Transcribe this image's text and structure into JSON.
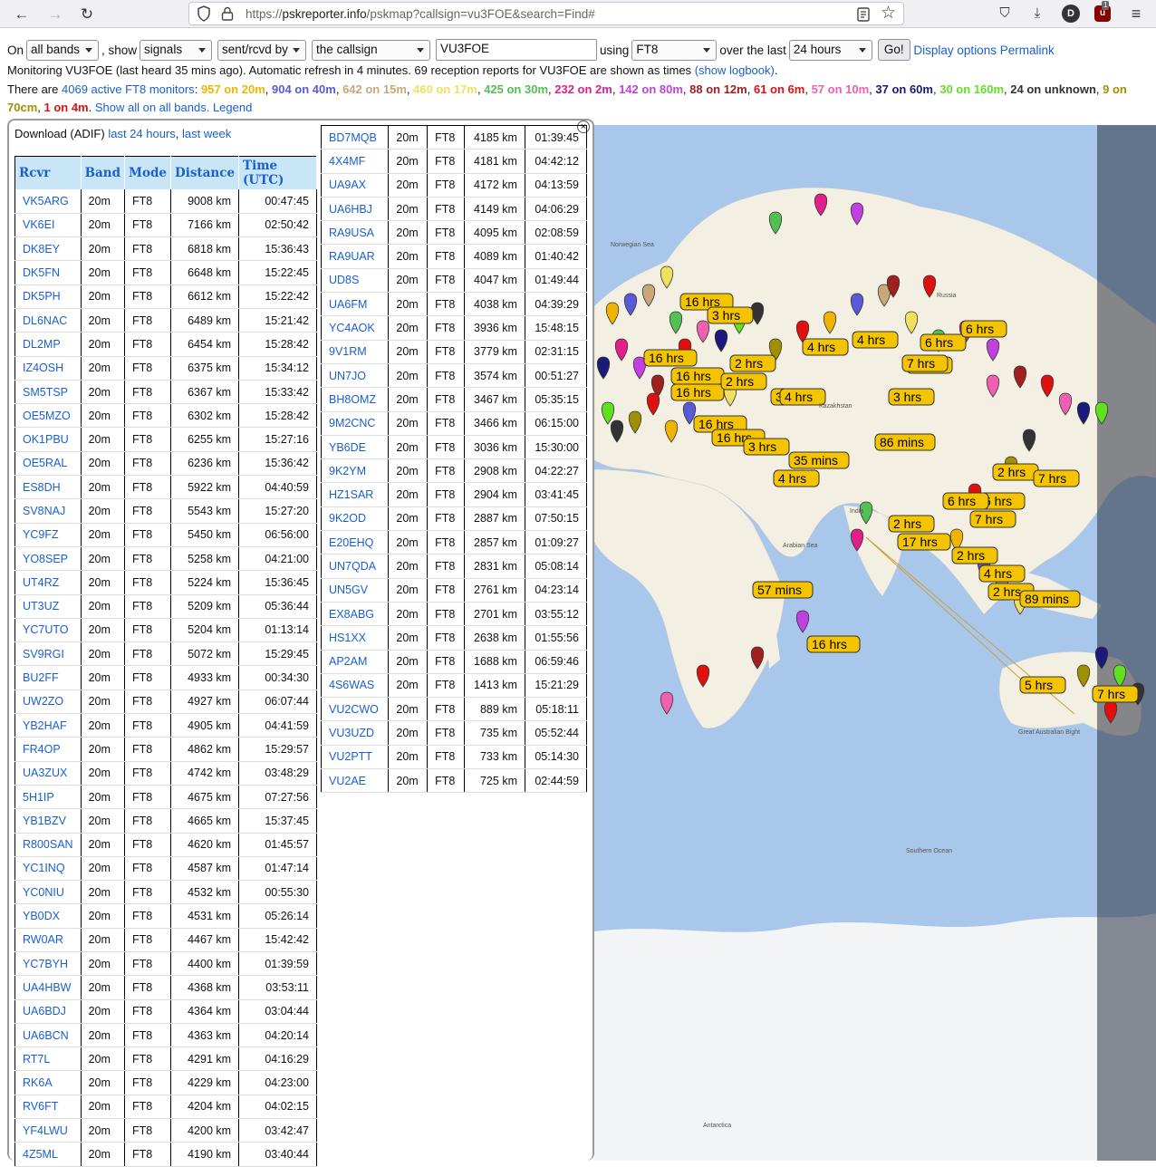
{
  "browser": {
    "url_prefix": "https://",
    "url_host": "pskreporter.info",
    "url_rest": "/pskmap?callsign=vu3FOE&search=Find#",
    "profile_initial": "D",
    "ublock_badge": "1"
  },
  "controls": {
    "on_label": "On",
    "bands_value": "all bands",
    "show_label": ", show",
    "show_value": "signals",
    "direction_value": "sent/rcvd by",
    "who_value": "the callsign",
    "callsign_value": "VU3FOE",
    "using_label": "using",
    "mode_value": "FT8",
    "over_label": "over the last",
    "period_value": "24 hours",
    "go_label": "Go!",
    "display_options": "Display options",
    "permalink": "Permalink"
  },
  "status": {
    "monitoring_text": "Monitoring VU3FOE (last heard 35 mins ago). Automatic refresh in 4 minutes. 69 reception reports for VU3FOE are shown as times",
    "show_logbook": "(show logbook)",
    "period": "."
  },
  "bands": {
    "prefix": "There are",
    "monitors_link": "4069 active FT8 monitors",
    "colon": ":",
    "items": [
      {
        "text": "957 on 20m",
        "color": "#f0b400"
      },
      {
        "text": "904 on 40m",
        "color": "#5a5ad8"
      },
      {
        "text": "642 on 15m",
        "color": "#c8a878"
      },
      {
        "text": "460 on 17m",
        "color": "#f0e060"
      },
      {
        "text": "425 on 30m",
        "color": "#52c052"
      },
      {
        "text": "232 on 2m",
        "color": "#e0208a"
      },
      {
        "text": "142 on 80m",
        "color": "#c040e0"
      },
      {
        "text": "88 on 12m",
        "color": "#a02020"
      },
      {
        "text": "61 on 6m",
        "color": "#e01010"
      },
      {
        "text": "57 on 10m",
        "color": "#f060b0"
      },
      {
        "text": "37 on 60m",
        "color": "#1a1a7a"
      },
      {
        "text": "30 on 160m",
        "color": "#60e020"
      },
      {
        "text": "24 on unknown",
        "color": "#333333"
      },
      {
        "text": "9 on 70cm",
        "color": "#a09000"
      },
      {
        "text": "1 on 4m",
        "color": "#e01010"
      }
    ],
    "show_all": "Show all on all bands.",
    "legend": "Legend"
  },
  "panel": {
    "download_label": "Download (ADIF)",
    "last24": "last 24 hours",
    "comma": ",",
    "lastweek": "last week",
    "close": "×",
    "headers": [
      "Rcvr",
      "Band",
      "Mode",
      "Distance",
      "Time (UTC)"
    ]
  },
  "reports_left": [
    [
      "VK5ARG",
      "20m",
      "FT8",
      "9008 km",
      "00:47:45"
    ],
    [
      "VK6EI",
      "20m",
      "FT8",
      "7166 km",
      "02:50:42"
    ],
    [
      "DK8EY",
      "20m",
      "FT8",
      "6818 km",
      "15:36:43"
    ],
    [
      "DK5FN",
      "20m",
      "FT8",
      "6648 km",
      "15:22:45"
    ],
    [
      "DK5PH",
      "20m",
      "FT8",
      "6612 km",
      "15:22:42"
    ],
    [
      "DL6NAC",
      "20m",
      "FT8",
      "6489 km",
      "15:21:42"
    ],
    [
      "DL2MP",
      "20m",
      "FT8",
      "6454 km",
      "15:28:42"
    ],
    [
      "IZ4OSH",
      "20m",
      "FT8",
      "6375 km",
      "15:34:12"
    ],
    [
      "SM5TSP",
      "20m",
      "FT8",
      "6367 km",
      "15:33:42"
    ],
    [
      "OE5MZO",
      "20m",
      "FT8",
      "6302 km",
      "15:28:42"
    ],
    [
      "OK1PBU",
      "20m",
      "FT8",
      "6255 km",
      "15:27:16"
    ],
    [
      "OE5RAL",
      "20m",
      "FT8",
      "6236 km",
      "15:36:42"
    ],
    [
      "ES8DH",
      "20m",
      "FT8",
      "5922 km",
      "04:40:59"
    ],
    [
      "SV8NAJ",
      "20m",
      "FT8",
      "5543 km",
      "15:27:20"
    ],
    [
      "YC9FZ",
      "20m",
      "FT8",
      "5450 km",
      "06:56:00"
    ],
    [
      "YO8SEP",
      "20m",
      "FT8",
      "5258 km",
      "04:21:00"
    ],
    [
      "UT4RZ",
      "20m",
      "FT8",
      "5224 km",
      "15:36:45"
    ],
    [
      "UT3UZ",
      "20m",
      "FT8",
      "5209 km",
      "05:36:44"
    ],
    [
      "YC7UTO",
      "20m",
      "FT8",
      "5204 km",
      "01:13:14"
    ],
    [
      "SV9RGI",
      "20m",
      "FT8",
      "5072 km",
      "15:29:45"
    ],
    [
      "BU2FF",
      "20m",
      "FT8",
      "4933 km",
      "00:34:30"
    ],
    [
      "UW2ZO",
      "20m",
      "FT8",
      "4927 km",
      "06:07:44"
    ],
    [
      "YB2HAF",
      "20m",
      "FT8",
      "4905 km",
      "04:41:59"
    ],
    [
      "FR4OP",
      "20m",
      "FT8",
      "4862 km",
      "15:29:57"
    ],
    [
      "UA3ZUX",
      "20m",
      "FT8",
      "4742 km",
      "03:48:29"
    ],
    [
      "5H1IP",
      "20m",
      "FT8",
      "4675 km",
      "07:27:56"
    ],
    [
      "YB1BZV",
      "20m",
      "FT8",
      "4665 km",
      "15:37:45"
    ],
    [
      "R800SAN",
      "20m",
      "FT8",
      "4620 km",
      "01:45:57"
    ],
    [
      "YC1INQ",
      "20m",
      "FT8",
      "4587 km",
      "01:47:14"
    ],
    [
      "YC0NIU",
      "20m",
      "FT8",
      "4532 km",
      "00:55:30"
    ],
    [
      "YB0DX",
      "20m",
      "FT8",
      "4531 km",
      "05:26:14"
    ],
    [
      "RW0AR",
      "20m",
      "FT8",
      "4467 km",
      "15:42:42"
    ],
    [
      "YC7BYH",
      "20m",
      "FT8",
      "4400 km",
      "01:39:59"
    ],
    [
      "UA4HBW",
      "20m",
      "FT8",
      "4368 km",
      "03:53:11"
    ],
    [
      "UA6BDJ",
      "20m",
      "FT8",
      "4364 km",
      "03:04:44"
    ],
    [
      "UA6BCN",
      "20m",
      "FT8",
      "4363 km",
      "04:20:14"
    ],
    [
      "RT7L",
      "20m",
      "FT8",
      "4291 km",
      "04:16:29"
    ],
    [
      "RK6A",
      "20m",
      "FT8",
      "4229 km",
      "04:23:00"
    ],
    [
      "RV6FT",
      "20m",
      "FT8",
      "4204 km",
      "04:02:15"
    ],
    [
      "YF4LWU",
      "20m",
      "FT8",
      "4200 km",
      "03:42:47"
    ],
    [
      "4Z5ML",
      "20m",
      "FT8",
      "4190 km",
      "03:40:44"
    ]
  ],
  "reports_right": [
    [
      "BD7MQB",
      "20m",
      "FT8",
      "4185 km",
      "01:39:45"
    ],
    [
      "4X4MF",
      "20m",
      "FT8",
      "4181 km",
      "04:42:12"
    ],
    [
      "UA9AX",
      "20m",
      "FT8",
      "4172 km",
      "04:13:59"
    ],
    [
      "UA6HBJ",
      "20m",
      "FT8",
      "4149 km",
      "04:06:29"
    ],
    [
      "RA9USA",
      "20m",
      "FT8",
      "4095 km",
      "02:08:59"
    ],
    [
      "RA9UAR",
      "20m",
      "FT8",
      "4089 km",
      "01:40:42"
    ],
    [
      "UD8S",
      "20m",
      "FT8",
      "4047 km",
      "01:49:44"
    ],
    [
      "UA6FM",
      "20m",
      "FT8",
      "4038 km",
      "04:39:29"
    ],
    [
      "YC4AOK",
      "20m",
      "FT8",
      "3936 km",
      "15:48:15"
    ],
    [
      "9V1RM",
      "20m",
      "FT8",
      "3779 km",
      "02:31:15"
    ],
    [
      "UN7JO",
      "20m",
      "FT8",
      "3574 km",
      "00:51:27"
    ],
    [
      "BH8OMZ",
      "20m",
      "FT8",
      "3467 km",
      "05:35:15"
    ],
    [
      "9M2CNC",
      "20m",
      "FT8",
      "3466 km",
      "06:15:00"
    ],
    [
      "YB6DE",
      "20m",
      "FT8",
      "3036 km",
      "15:30:00"
    ],
    [
      "9K2YM",
      "20m",
      "FT8",
      "2908 km",
      "04:22:27"
    ],
    [
      "HZ1SAR",
      "20m",
      "FT8",
      "2904 km",
      "03:41:45"
    ],
    [
      "9K2OD",
      "20m",
      "FT8",
      "2887 km",
      "07:50:15"
    ],
    [
      "E20EHQ",
      "20m",
      "FT8",
      "2857 km",
      "01:09:27"
    ],
    [
      "UN7QDA",
      "20m",
      "FT8",
      "2831 km",
      "05:08:14"
    ],
    [
      "UN5GV",
      "20m",
      "FT8",
      "2761 km",
      "04:23:14"
    ],
    [
      "EX8ABG",
      "20m",
      "FT8",
      "2701 km",
      "03:55:12"
    ],
    [
      "HS1XX",
      "20m",
      "FT8",
      "2638 km",
      "01:55:56"
    ],
    [
      "AP2AM",
      "20m",
      "FT8",
      "1688 km",
      "06:59:46"
    ],
    [
      "4S6WAS",
      "20m",
      "FT8",
      "1413 km",
      "15:21:29"
    ],
    [
      "VU2CWO",
      "20m",
      "FT8",
      "889 km",
      "05:18:11"
    ],
    [
      "VU3UZD",
      "20m",
      "FT8",
      "735 km",
      "05:52:44"
    ],
    [
      "VU2PTT",
      "20m",
      "FT8",
      "733 km",
      "05:14:30"
    ],
    [
      "VU2AE",
      "20m",
      "FT8",
      "725 km",
      "02:44:59"
    ]
  ],
  "map": {
    "time_labels": [
      "16 hrs",
      "3 hrs",
      "16 hrs",
      "16 hrs",
      "16 hrs",
      "2 hrs",
      "4 hrs",
      "2 hrs",
      "3 hrs",
      "4 hrs",
      "4 hrs",
      "6 hrs",
      "6 hrs",
      "6 hrs",
      "7 hrs",
      "3 hrs",
      "16 hrs",
      "16 hrs",
      "3 hrs",
      "86 mins",
      "35 mins",
      "4 hrs",
      "2 hrs",
      "6 hrs",
      "6 hrs",
      "7 hrs",
      "7 hrs",
      "2 hrs",
      "17 hrs",
      "2 hrs",
      "4 hrs",
      "2 hrs",
      "89 mins",
      "57 mins",
      "16 hrs",
      "5 hrs",
      "7 hrs"
    ],
    "place_names": [
      "Norwegian Sea",
      "Russia",
      "Kazakhstan",
      "India",
      "Southern Ocean",
      "Antarctica",
      "Great Australian Bight",
      "Arabian Sea"
    ]
  }
}
